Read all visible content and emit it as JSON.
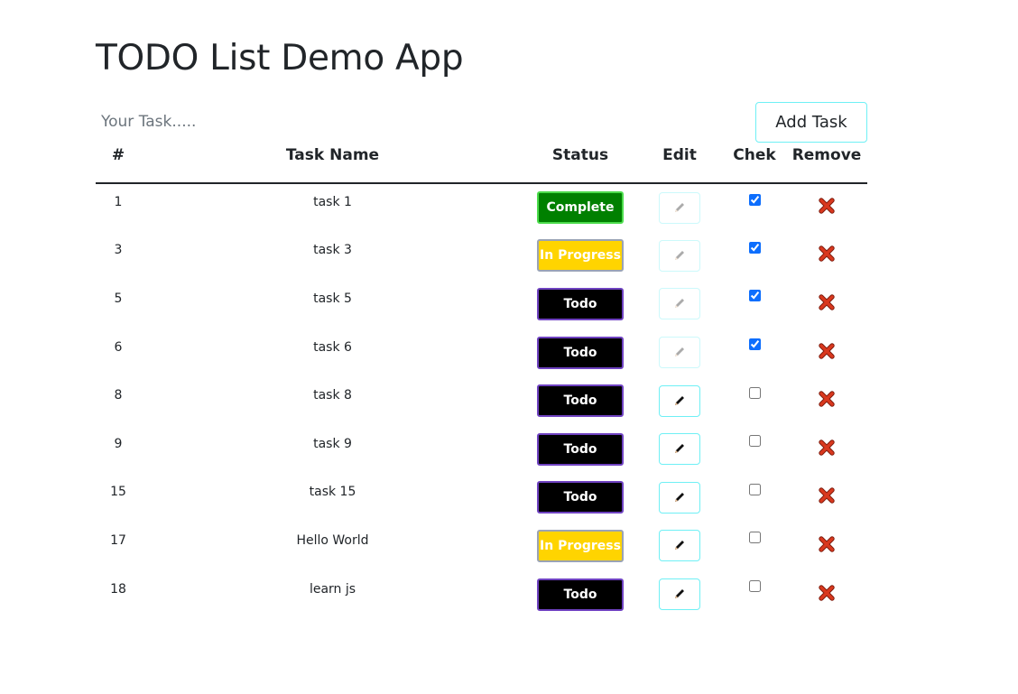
{
  "app": {
    "title": "TODO List Demo App"
  },
  "input": {
    "placeholder": "Your Task.....",
    "value": ""
  },
  "add_button": {
    "label": "Add Task"
  },
  "table": {
    "columns": [
      "#",
      "Task Name",
      "Status",
      "Edit",
      "Chek",
      "Remove"
    ],
    "rows": [
      {
        "id": "1",
        "name": "task 1",
        "status": "Complete",
        "checked": true,
        "edit_enabled": false
      },
      {
        "id": "3",
        "name": "task 3",
        "status": "In Progress",
        "checked": true,
        "edit_enabled": false
      },
      {
        "id": "5",
        "name": "task 5",
        "status": "Todo",
        "checked": true,
        "edit_enabled": false
      },
      {
        "id": "6",
        "name": "task 6",
        "status": "Todo",
        "checked": true,
        "edit_enabled": false
      },
      {
        "id": "8",
        "name": "task 8",
        "status": "Todo",
        "checked": false,
        "edit_enabled": true
      },
      {
        "id": "9",
        "name": "task 9",
        "status": "Todo",
        "checked": false,
        "edit_enabled": true
      },
      {
        "id": "15",
        "name": "task 15",
        "status": "Todo",
        "checked": false,
        "edit_enabled": true
      },
      {
        "id": "17",
        "name": "Hello World",
        "status": "In Progress",
        "checked": false,
        "edit_enabled": true
      },
      {
        "id": "18",
        "name": "learn js",
        "status": "Todo",
        "checked": false,
        "edit_enabled": true
      }
    ]
  },
  "icons": {
    "edit": "pencil-icon",
    "remove": "close-icon"
  },
  "colors": {
    "complete_bg": "#008000",
    "in_progress_bg": "#ffd400",
    "todo_bg": "#000000",
    "accent_border": "#6ff0f5",
    "remove_icon": "#d9381e"
  }
}
